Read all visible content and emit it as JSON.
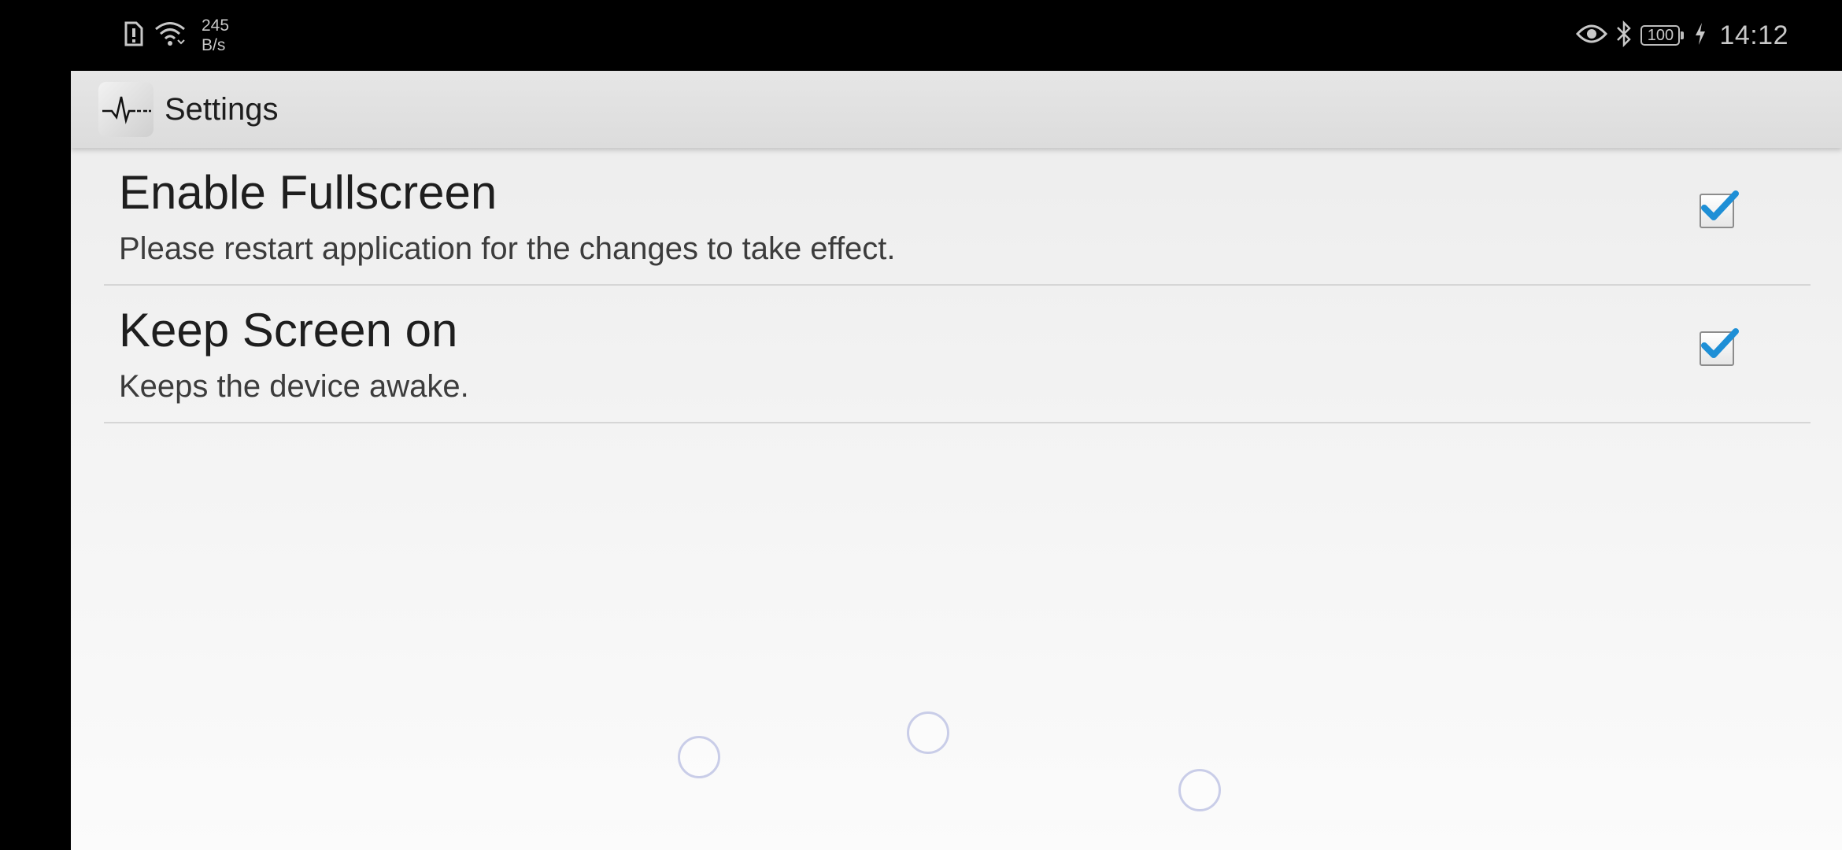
{
  "status_bar": {
    "speed_value": "245",
    "speed_unit": "B/s",
    "battery_level": "100",
    "time": "14:12",
    "icons": [
      "sim-alert-icon",
      "wifi-icon",
      "eye-icon",
      "bluetooth-icon",
      "battery-icon",
      "charging-icon"
    ]
  },
  "app_bar": {
    "title": "Settings",
    "icon": "app-waveform-icon"
  },
  "preferences": [
    {
      "title": "Enable Fullscreen",
      "summary": "Please restart application for the changes to take effect.",
      "checked": true
    },
    {
      "title": "Keep Screen on",
      "summary": "Keeps the device awake.",
      "checked": true
    }
  ],
  "colors": {
    "check_accent": "#1e8fd6",
    "title_bar": "#dcdcdc",
    "divider": "#d6d6d6"
  }
}
